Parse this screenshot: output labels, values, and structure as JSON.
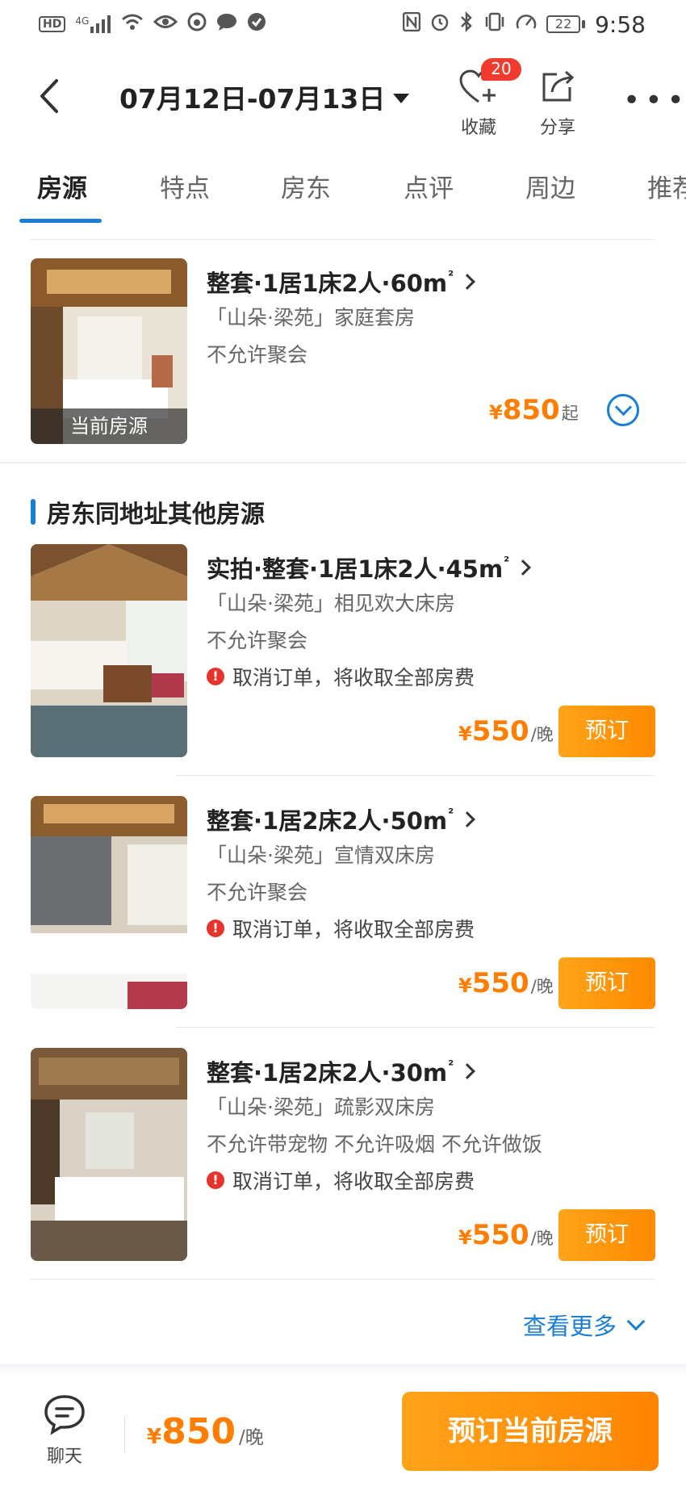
{
  "status_bar": {
    "left_chip": "HD",
    "network": "4G",
    "battery_level": "22",
    "time": "9:58",
    "left_icons": [
      "hd-icon",
      "signal-icon",
      "wifi-icon",
      "eye-icon",
      "weibo-icon",
      "chat-bubble-icon",
      "shield-icon"
    ],
    "right_icons": [
      "nfc-icon",
      "alarm-icon",
      "bluetooth-icon",
      "vibrate-icon",
      "speedometer-icon",
      "battery-icon"
    ]
  },
  "header": {
    "date_range": "07月12日-07月13日",
    "favorite_label": "收藏",
    "favorite_count": "20",
    "share_label": "分享"
  },
  "tabs": [
    "房源",
    "特点",
    "房东",
    "点评",
    "周边",
    "推荐"
  ],
  "current_listing": {
    "title": "整套·1居1床2人·60m",
    "area_sup": "²",
    "name": "「山朵·梁苑」家庭套房",
    "rule": "不允许聚会",
    "tag": "当前房源",
    "price_currency": "¥",
    "price": "850",
    "price_suffix": "起"
  },
  "other_section_title": "房东同地址其他房源",
  "other_listings": [
    {
      "title": "实拍·整套·1居1床2人·45m",
      "area_sup": "²",
      "name": "「山朵·梁苑」相见欢大床房",
      "rules": "不允许聚会",
      "cancel_policy": "取消订单，将收取全部房费",
      "price_currency": "¥",
      "price": "550",
      "price_unit": "/晚",
      "book_label": "预订"
    },
    {
      "title": "整套·1居2床2人·50m",
      "area_sup": "²",
      "name": "「山朵·梁苑」宣情双床房",
      "rules": "不允许聚会",
      "cancel_policy": "取消订单，将收取全部房费",
      "price_currency": "¥",
      "price": "550",
      "price_unit": "/晚",
      "book_label": "预订"
    },
    {
      "title": "整套·1居2床2人·30m",
      "area_sup": "²",
      "name": "「山朵·梁苑」疏影双床房",
      "rules": "不允许带宠物 不允许吸烟 不允许做饭",
      "cancel_policy": "取消订单，将收取全部房费",
      "price_currency": "¥",
      "price": "550",
      "price_unit": "/晚",
      "book_label": "预订"
    }
  ],
  "see_more_label": "查看更多",
  "bottom_bar": {
    "chat_label": "聊天",
    "price_currency": "¥",
    "price": "850",
    "price_unit": "/晚",
    "book_label": "预订当前房源"
  },
  "colors": {
    "accent_blue": "#1a7ed6",
    "price_orange": "#ff7d00",
    "button_orange": "#ff8a00",
    "badge_red": "#f23b2f",
    "warning_red": "#e8322c"
  }
}
